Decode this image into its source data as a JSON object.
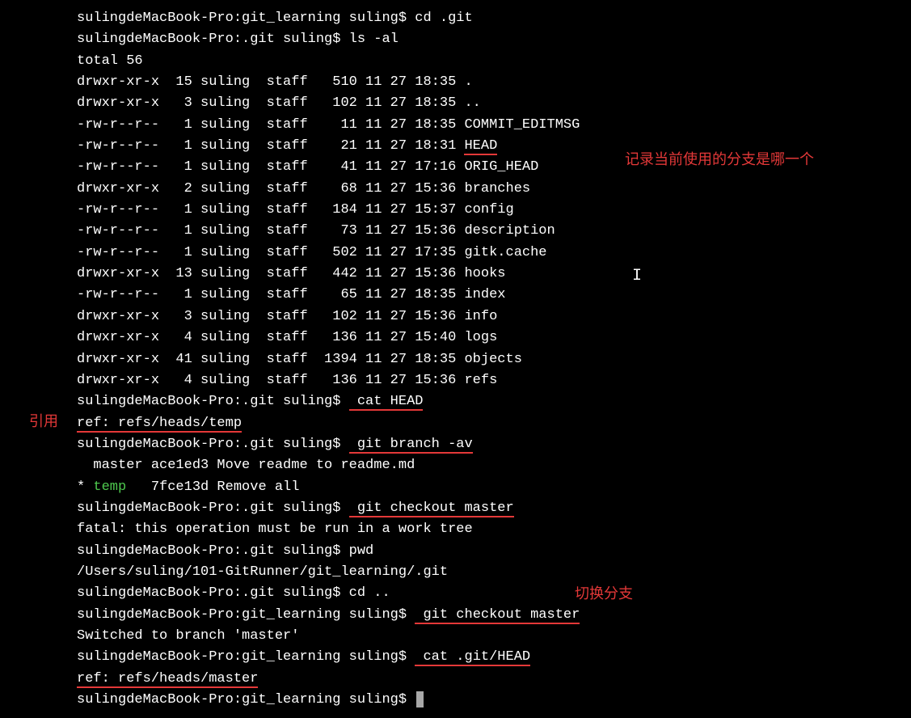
{
  "prompts": {
    "git_learning": "sulingdeMacBook-Pro:git_learning suling$",
    "dot_git": "sulingdeMacBook-Pro:.git suling$"
  },
  "commands": {
    "cd_git": " cd .git",
    "ls_al": " ls -al",
    "cat_head": " cat HEAD",
    "git_branch": " git branch -av",
    "git_checkout_master": " git checkout master",
    "pwd": " pwd",
    "cd_up": " cd ..",
    "cat_git_head": " cat .git/HEAD"
  },
  "output": {
    "total": "total 56",
    "ls_rows": [
      "drwxr-xr-x  15 suling  staff   510 11 27 18:35 .",
      "drwxr-xr-x   3 suling  staff   102 11 27 18:35 ..",
      "-rw-r--r--   1 suling  staff    11 11 27 18:35 COMMIT_EDITMSG"
    ],
    "head_row_prefix": "-rw-r--r--   1 suling  staff    21 11 27 18:31 ",
    "head_row_name": "HEAD",
    "ls_rows2": [
      "-rw-r--r--   1 suling  staff    41 11 27 17:16 ORIG_HEAD",
      "drwxr-xr-x   2 suling  staff    68 11 27 15:36 branches",
      "-rw-r--r--   1 suling  staff   184 11 27 15:37 config",
      "-rw-r--r--   1 suling  staff    73 11 27 15:36 description",
      "-rw-r--r--   1 suling  staff   502 11 27 17:35 gitk.cache",
      "drwxr-xr-x  13 suling  staff   442 11 27 15:36 hooks",
      "-rw-r--r--   1 suling  staff    65 11 27 18:35 index",
      "drwxr-xr-x   3 suling  staff   102 11 27 15:36 info",
      "drwxr-xr-x   4 suling  staff   136 11 27 15:40 logs",
      "drwxr-xr-x  41 suling  staff  1394 11 27 18:35 objects",
      "drwxr-xr-x   4 suling  staff   136 11 27 15:36 refs"
    ],
    "ref_temp": "ref: refs/heads/temp",
    "branch_master": "  master ace1ed3 Move readme to readme.md",
    "branch_star": "* ",
    "branch_temp": "temp",
    "branch_temp_rest": "   7fce13d Remove all",
    "fatal": "fatal: this operation must be run in a work tree",
    "pwd_out": "/Users/suling/101-GitRunner/git_learning/.git",
    "switched": "Switched to branch 'master'",
    "ref_master": "ref: refs/heads/master"
  },
  "annotations": {
    "record_branch": "记录当前使用的分支是哪一个",
    "ref": "引用",
    "switch_branch": "切换分支"
  }
}
